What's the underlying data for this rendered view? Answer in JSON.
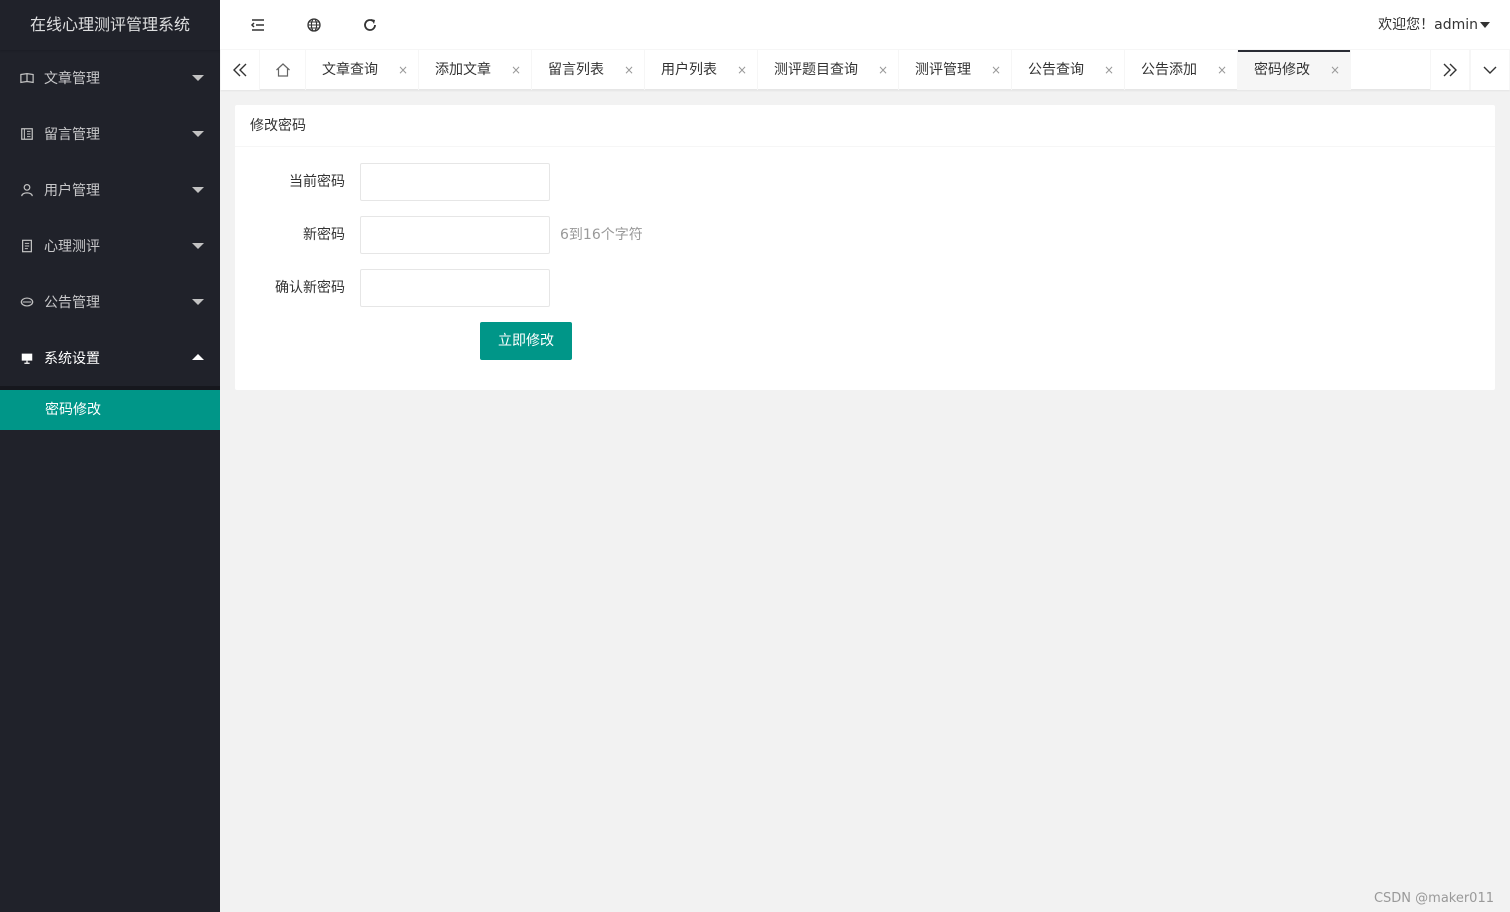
{
  "app": {
    "title": "在线心理测评管理系统"
  },
  "sidebar": {
    "items": [
      {
        "label": "文章管理",
        "icon": "reading-icon"
      },
      {
        "label": "留言管理",
        "icon": "book-icon"
      },
      {
        "label": "用户管理",
        "icon": "user-icon"
      },
      {
        "label": "心理测评",
        "icon": "form-icon"
      },
      {
        "label": "公告管理",
        "icon": "speaker-icon"
      },
      {
        "label": "系统设置",
        "icon": "monitor-icon",
        "expanded": true
      }
    ],
    "submenu": [
      {
        "label": "密码修改",
        "active": true
      }
    ]
  },
  "header": {
    "user_text": "欢迎您！admin"
  },
  "tabs": [
    {
      "label": "文章查询",
      "close": "×"
    },
    {
      "label": "添加文章",
      "close": "×"
    },
    {
      "label": "留言列表",
      "close": "×"
    },
    {
      "label": "用户列表",
      "close": "×"
    },
    {
      "label": "测评题目查询",
      "close": "×"
    },
    {
      "label": "测评管理",
      "close": "×"
    },
    {
      "label": "公告查询",
      "close": "×"
    },
    {
      "label": "公告添加",
      "close": "×"
    },
    {
      "label": "密码修改",
      "close": "×",
      "active": true
    }
  ],
  "form": {
    "title": "修改密码",
    "current_password_label": "当前密码",
    "current_password_value": "",
    "new_password_label": "新密码",
    "new_password_value": "",
    "new_password_hint": "6到16个字符",
    "confirm_password_label": "确认新密码",
    "confirm_password_value": "",
    "submit_label": "立即修改"
  },
  "watermark": "CSDN @maker011",
  "colors": {
    "accent": "#009688",
    "sidebar": "#20222a",
    "background": "#f2f2f2"
  }
}
